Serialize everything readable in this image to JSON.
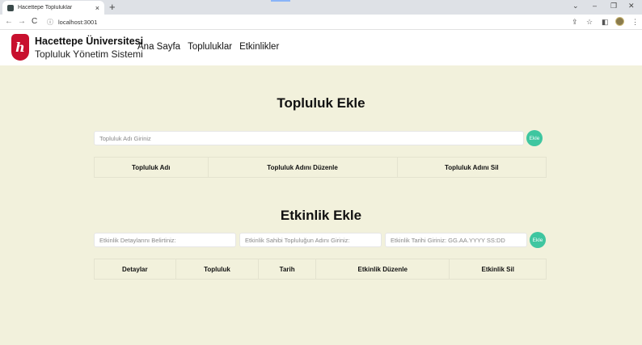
{
  "browser": {
    "tab_title": "Hacettepe Topluluklar",
    "tab_close": "×",
    "new_tab": "+",
    "url": "localhost:3001",
    "back": "←",
    "forward": "→",
    "reload": "C",
    "info_icon": "ⓘ",
    "share_icon": "⇪",
    "star_icon": "☆",
    "sidepanel_icon": "◧",
    "menu_icon": "⋮",
    "minimize": "–",
    "maximize": "❐",
    "close": "✕",
    "chevron": "⌄"
  },
  "header": {
    "logo_letter": "h",
    "brand_title": "Hacettepe Üniversitesi",
    "brand_subtitle": "Topluluk Yönetim Sistemi",
    "nav": [
      "Ana Sayfa",
      "Topluluklar",
      "Etkinlikler"
    ]
  },
  "community": {
    "title": "Topluluk Ekle",
    "name_placeholder": "Topluluk Adı Giriniz",
    "add_label": "Ekle",
    "columns": [
      "Topluluk Adı",
      "Topluluk Adını Düzenle",
      "Topluluk Adını Sil"
    ]
  },
  "event": {
    "title": "Etkinlik Ekle",
    "details_placeholder": "Etkinlik Detaylarını Belirtiniz:",
    "owner_placeholder": "Etkinlik Sahibi Topluluğun Adını Giriniz:",
    "date_placeholder": "Etkinlik Tarihi Giriniz: GG.AA.YYYY SS:DD",
    "add_label": "Ekle",
    "columns": [
      "Detaylar",
      "Topluluk",
      "Tarih",
      "Etkinlik Düzenle",
      "Etkinlik Sil"
    ]
  },
  "colors": {
    "page_bg": "#f2f1dc",
    "accent": "#3fc6a0",
    "logo_red": "#c8102e"
  }
}
